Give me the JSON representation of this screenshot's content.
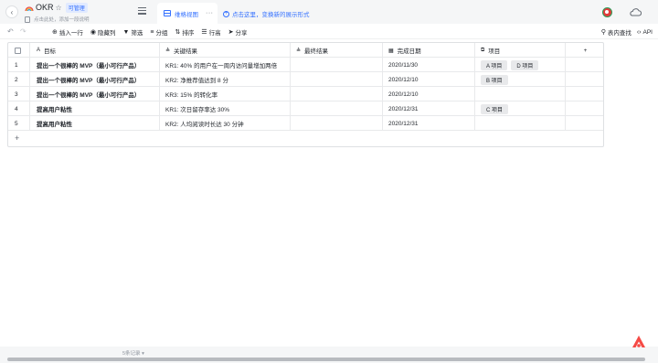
{
  "header": {
    "title": "OKR",
    "permission_badge": "可管理",
    "subtitle": "点击此处，添加一段说明",
    "view_tab": "维格视图",
    "view_more": "···",
    "add_view": "点击这里，变换新的展示形式"
  },
  "toolbar": {
    "insert_row": "插入一行",
    "hide_columns": "隐藏列",
    "filter": "筛选",
    "group": "分组",
    "sort": "排序",
    "row_height": "行高",
    "share": "分享",
    "find_in_table": "表内查找",
    "api": "API"
  },
  "table": {
    "columns": {
      "goal": "目标",
      "key_result": "关键结果",
      "final_result": "最终结果",
      "due_date": "完成日期",
      "project": "项目"
    },
    "rows": [
      {
        "num": "1",
        "goal": "提出一个很棒的 MVP（最小可行产品）",
        "key_result": "KR1: 40% 的用户在一周内访问量增加两倍",
        "final_result": "",
        "due_date": "2020/11/30",
        "projects": [
          "A 项目",
          "D 项目"
        ]
      },
      {
        "num": "2",
        "goal": "提出一个很棒的 MVP（最小可行产品）",
        "key_result": "KR2: 净推荐值达到 8 分",
        "final_result": "",
        "due_date": "2020/12/10",
        "projects": [
          "B 项目"
        ]
      },
      {
        "num": "3",
        "goal": "提出一个很棒的 MVP（最小可行产品）",
        "key_result": "KR3: 15% 的转化率",
        "final_result": "",
        "due_date": "2020/12/10",
        "projects": []
      },
      {
        "num": "4",
        "goal": "提高用户粘性",
        "key_result": "KR1: 次日留存率达 30%",
        "final_result": "",
        "due_date": "2020/12/31",
        "projects": [
          "C 项目"
        ]
      },
      {
        "num": "5",
        "goal": "提高用户粘性",
        "key_result": "KR2: 人均阅读时长达 30 分钟",
        "final_result": "",
        "due_date": "2020/12/31",
        "projects": []
      }
    ]
  },
  "footer": {
    "record_count": "5条记录 ▾"
  },
  "icons": {
    "back": "chevron-left-icon",
    "star": "star-icon",
    "menu": "menu-icon",
    "grid_view": "grid-view-icon",
    "cloud": "cloud-icon"
  },
  "colors": {
    "accent": "#3370ff",
    "tag_bg": "#e8e9eb",
    "brand": "#f54a45"
  }
}
